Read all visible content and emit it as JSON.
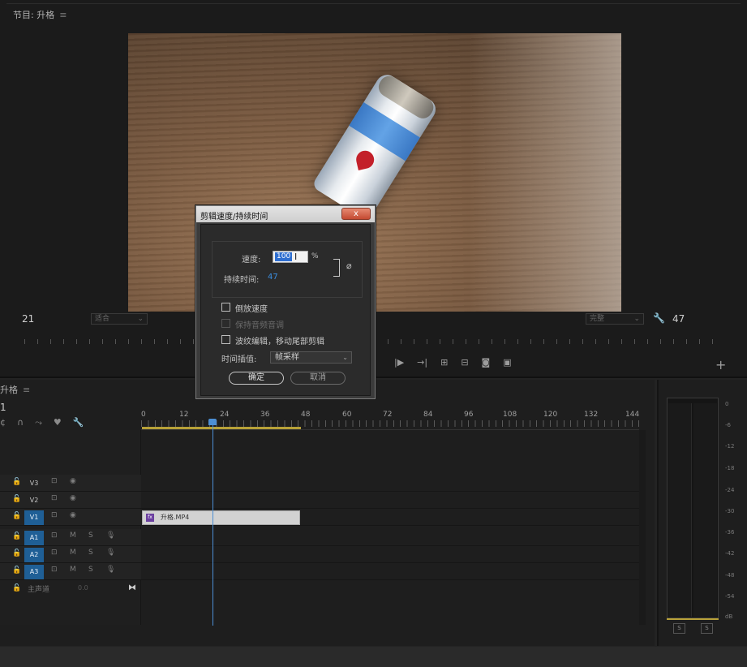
{
  "program": {
    "tab_title": "节目: 升格",
    "timecode_left": "21",
    "timecode_right": "47",
    "zoom_select": "适合",
    "quality_select": "完整"
  },
  "sequence": {
    "tab_title": "升格",
    "timecode": "1",
    "ruler_labels": [
      "0",
      "12",
      "24",
      "36",
      "48",
      "60",
      "72",
      "84",
      "96",
      "108",
      "120",
      "132",
      "144"
    ],
    "tracks": [
      {
        "name": "V3",
        "type": "video",
        "targeted": false
      },
      {
        "name": "V2",
        "type": "video",
        "targeted": false
      },
      {
        "name": "V1",
        "type": "video",
        "targeted": true
      },
      {
        "name": "A1",
        "type": "audio",
        "targeted": true
      },
      {
        "name": "A2",
        "type": "audio",
        "targeted": true
      },
      {
        "name": "A3",
        "type": "audio",
        "targeted": true
      }
    ],
    "audio_controls": {
      "mute": "M",
      "solo": "S"
    },
    "clip_label": "升格.MP4",
    "clip_badge": "fx",
    "master_label": "主声道",
    "master_value": "0.0"
  },
  "meter": {
    "db_labels": [
      "0",
      "-6",
      "-12",
      "-18",
      "-24",
      "-30",
      "-36",
      "-42",
      "-48",
      "-54",
      "dB"
    ],
    "solo_left": "S",
    "solo_right": "S"
  },
  "dialog": {
    "title": "剪辑速度/持续时间",
    "close_glyph": "x",
    "speed_label": "速度:",
    "speed_value": "100",
    "speed_unit": "%",
    "duration_label": "持续时间:",
    "duration_value": "47",
    "checkboxes": [
      {
        "label": "倒放速度",
        "checked": false,
        "enabled": true
      },
      {
        "label": "保持音频音调",
        "checked": false,
        "enabled": false
      },
      {
        "label": "波纹编辑，移动尾部剪辑",
        "checked": false,
        "enabled": true
      }
    ],
    "interp_label": "时间插值:",
    "interp_value": "帧采样",
    "ok_label": "确定",
    "cancel_label": "取消"
  },
  "colors": {
    "accent_blue": "#2f6fd1",
    "track_target": "#1f5f96",
    "workarea_yellow": "#b8a138",
    "playhead": "#4c8fd4",
    "close_red": "#c44a32"
  }
}
